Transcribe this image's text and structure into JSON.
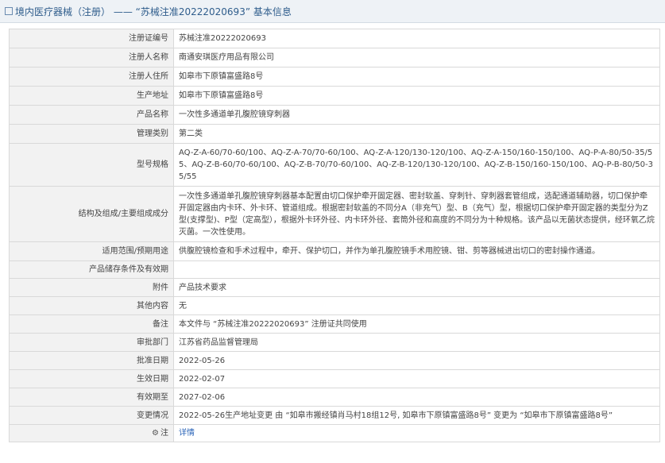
{
  "header": {
    "title": "境内医疗器械（注册） —— “苏械注准20222020693” 基本信息"
  },
  "rows": [
    {
      "label": "注册证编号",
      "value": "苏械注准20222020693"
    },
    {
      "label": "注册人名称",
      "value": "南通安琪医疗用品有限公司"
    },
    {
      "label": "注册人住所",
      "value": "如皋市下原镇富盛路8号"
    },
    {
      "label": "生产地址",
      "value": "如皋市下原镇富盛路8号"
    },
    {
      "label": "产品名称",
      "value": "一次性多通道单孔腹腔镜穿刺器"
    },
    {
      "label": "管理类别",
      "value": "第二类"
    },
    {
      "label": "型号规格",
      "value": "AQ-Z-A-60/70-60/100、AQ-Z-A-70/70-60/100、AQ-Z-A-120/130-120/100、AQ-Z-A-150/160-150/100、AQ-P-A-80/50-35/55、AQ-Z-B-60/70-60/100、AQ-Z-B-70/70-60/100、AQ-Z-B-120/130-120/100、AQ-Z-B-150/160-150/100、AQ-P-B-80/50-35/55"
    },
    {
      "label": "结构及组成/主要组成成分",
      "value": "一次性多通道单孔腹腔镜穿刺器基本配置由切口保护牵开固定器、密封软盖、穿刺针、穿刺器套管组成，选配通道辅助器，切口保护牵开固定器由内卡环、外卡环、管道组成。根据密封软盖的不同分A（非充气）型、B（充气）型，根据切口保护牵开固定器的类型分为Z型(支撑型)、P型（定高型），根据外卡环外径、内卡环外径、套筒外径和高度的不同分为十种规格。该产品以无菌状态提供，经环氧乙烷灭菌。一次性使用。"
    },
    {
      "label": "适用范围/预期用途",
      "value": "供腹腔镜检查和手术过程中，牵开、保护切口，并作为单孔腹腔镜手术用腔镜、钳、剪等器械进出切口的密封操作通道。"
    },
    {
      "label": "产品储存条件及有效期",
      "value": ""
    },
    {
      "label": "附件",
      "value": "产品技术要求"
    },
    {
      "label": "其他内容",
      "value": "无"
    },
    {
      "label": "备注",
      "value": "本文件与 “苏械注准20222020693” 注册证共同使用"
    },
    {
      "label": "审批部门",
      "value": "江苏省药品监督管理局"
    },
    {
      "label": "批准日期",
      "value": "2022-05-26"
    },
    {
      "label": "生效日期",
      "value": "2022-02-07"
    },
    {
      "label": "有效期至",
      "value": "2027-02-06"
    },
    {
      "label": "变更情况",
      "value": "2022-05-26生产地址变更 由 “如皋市搬经镇肖马村18组12号, 如皋市下原镇富盛路8号” 变更为 “如皋市下原镇富盛路8号”"
    },
    {
      "label": "注",
      "value": "详情"
    }
  ]
}
